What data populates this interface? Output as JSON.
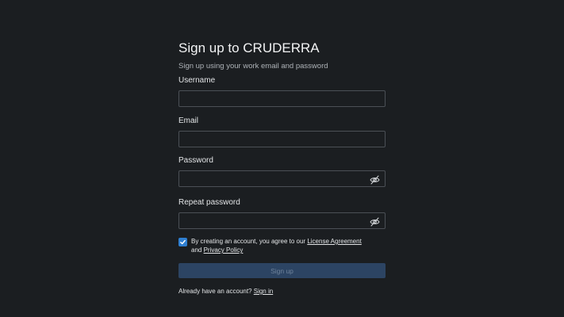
{
  "form": {
    "title": "Sign up to CRUDERRA",
    "subtitle": "Sign up using your work email and password",
    "fields": {
      "username": {
        "label": "Username",
        "value": "",
        "placeholder": ""
      },
      "email": {
        "label": "Email",
        "value": "",
        "placeholder": ""
      },
      "password": {
        "label": "Password",
        "value": "",
        "placeholder": "",
        "icon": "eye-off-icon"
      },
      "repeat_password": {
        "label": "Repeat password",
        "value": "",
        "placeholder": "",
        "icon": "eye-off-icon"
      }
    },
    "agreement": {
      "checked": true,
      "text_before": "By creating an account, you agree to our ",
      "license_link": "License Agreement",
      "text_and": "and ",
      "privacy_link": "Privacy Policy"
    },
    "submit_label": "Sign up",
    "signin": {
      "prompt": "Already have an account? ",
      "link": "Sign in"
    }
  },
  "colors": {
    "background": "#1b1e21",
    "checkbox": "#2f7fd1",
    "button_disabled": "#2c4463"
  }
}
